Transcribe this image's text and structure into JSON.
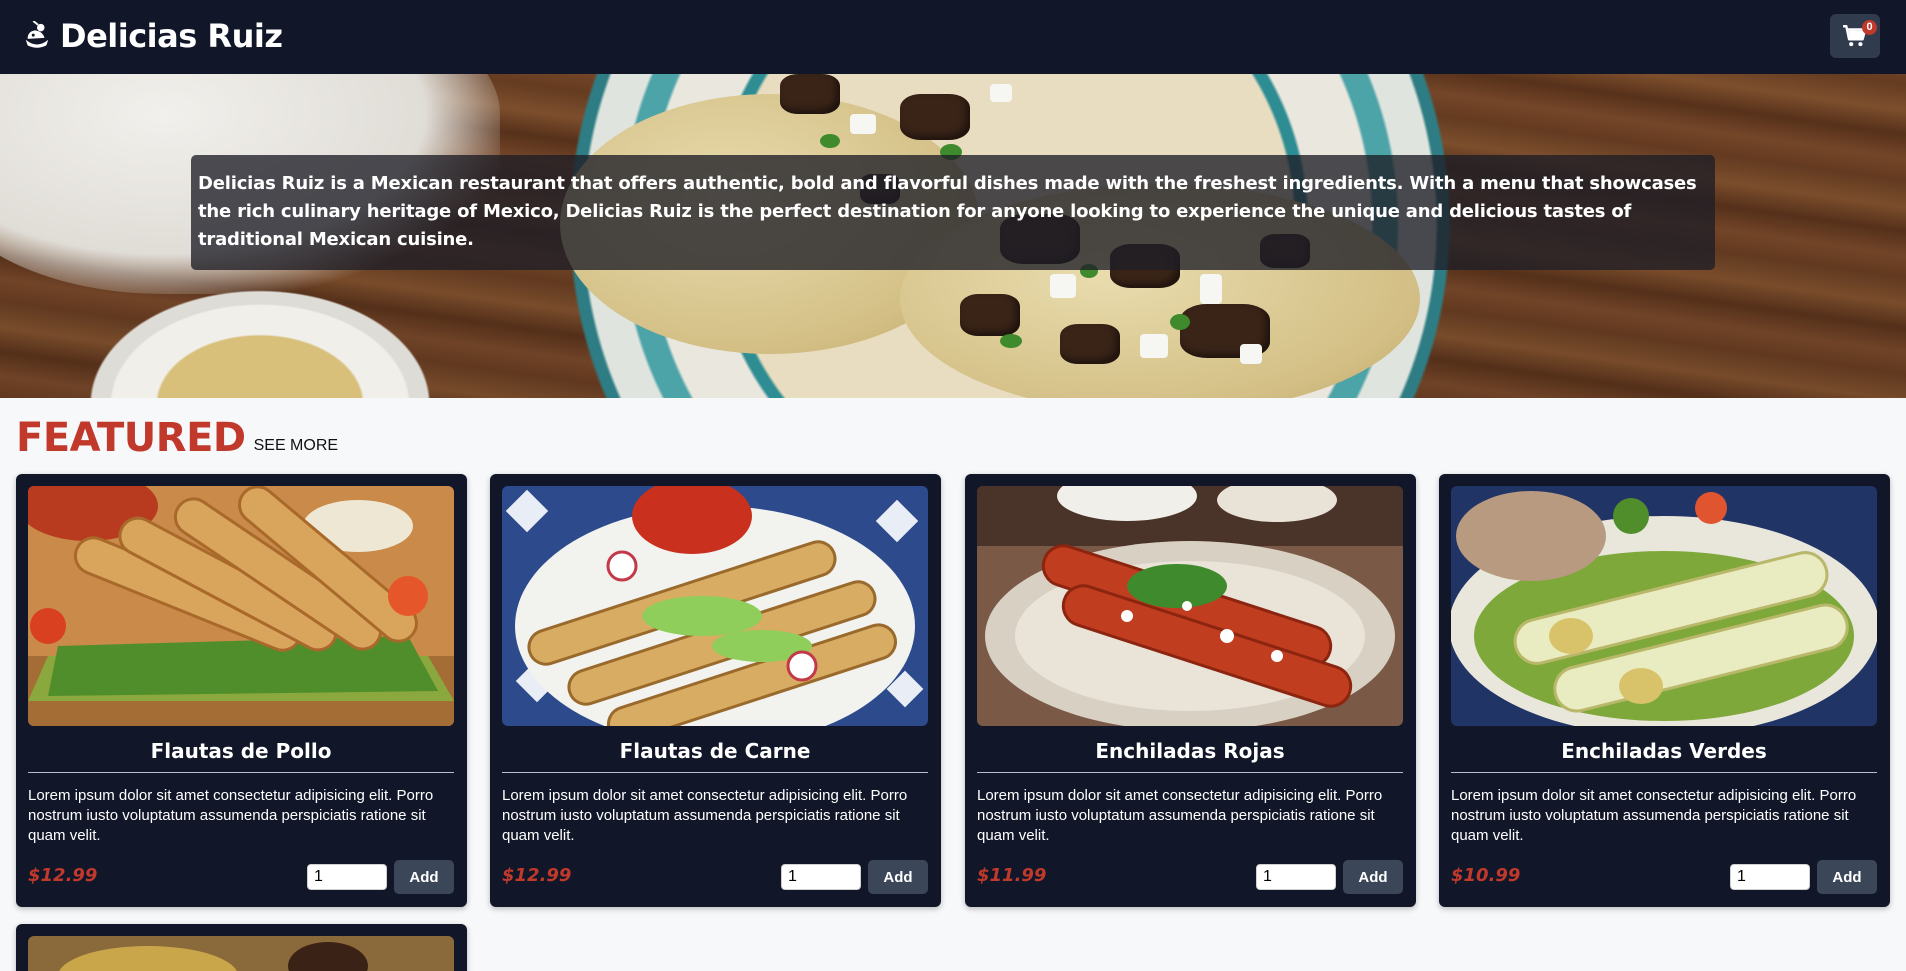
{
  "header": {
    "brand": "Delicias Ruiz",
    "cart_count": "0",
    "colors": {
      "bar": "#111729",
      "cart_button": "#313b4e",
      "badge": "#c0392b"
    },
    "icons": [
      "chef-logo-icon",
      "shopping-cart-icon"
    ]
  },
  "hero": {
    "caption": "Delicias Ruiz is a Mexican restaurant that offers authentic, bold and flavorful dishes made with the freshest ingredients. With a menu that showcases the rich culinary heritage of Mexico, Delicias Ruiz is the perfect destination for anyone looking to experience the unique and delicious tastes of traditional Mexican cuisine."
  },
  "featured": {
    "title": "FEATURED",
    "see_more": "SEE MORE",
    "accent_color": "#c0392b"
  },
  "products": [
    {
      "name": "Flautas de Pollo",
      "description": "Lorem ipsum dolor sit amet consectetur adipisicing elit. Porro nostrum iusto voluptatum assumenda perspiciatis ratione sit quam velit.",
      "price": "$12.99",
      "quantity": "1",
      "add_label": "Add"
    },
    {
      "name": "Flautas de Carne",
      "description": "Lorem ipsum dolor sit amet consectetur adipisicing elit. Porro nostrum iusto voluptatum assumenda perspiciatis ratione sit quam velit.",
      "price": "$12.99",
      "quantity": "1",
      "add_label": "Add"
    },
    {
      "name": "Enchiladas Rojas",
      "description": "Lorem ipsum dolor sit amet consectetur adipisicing elit. Porro nostrum iusto voluptatum assumenda perspiciatis ratione sit quam velit.",
      "price": "$11.99",
      "quantity": "1",
      "add_label": "Add"
    },
    {
      "name": "Enchiladas Verdes",
      "description": "Lorem ipsum dolor sit amet consectetur adipisicing elit. Porro nostrum iusto voluptatum assumenda perspiciatis ratione sit quam velit.",
      "price": "$10.99",
      "quantity": "1",
      "add_label": "Add"
    }
  ]
}
